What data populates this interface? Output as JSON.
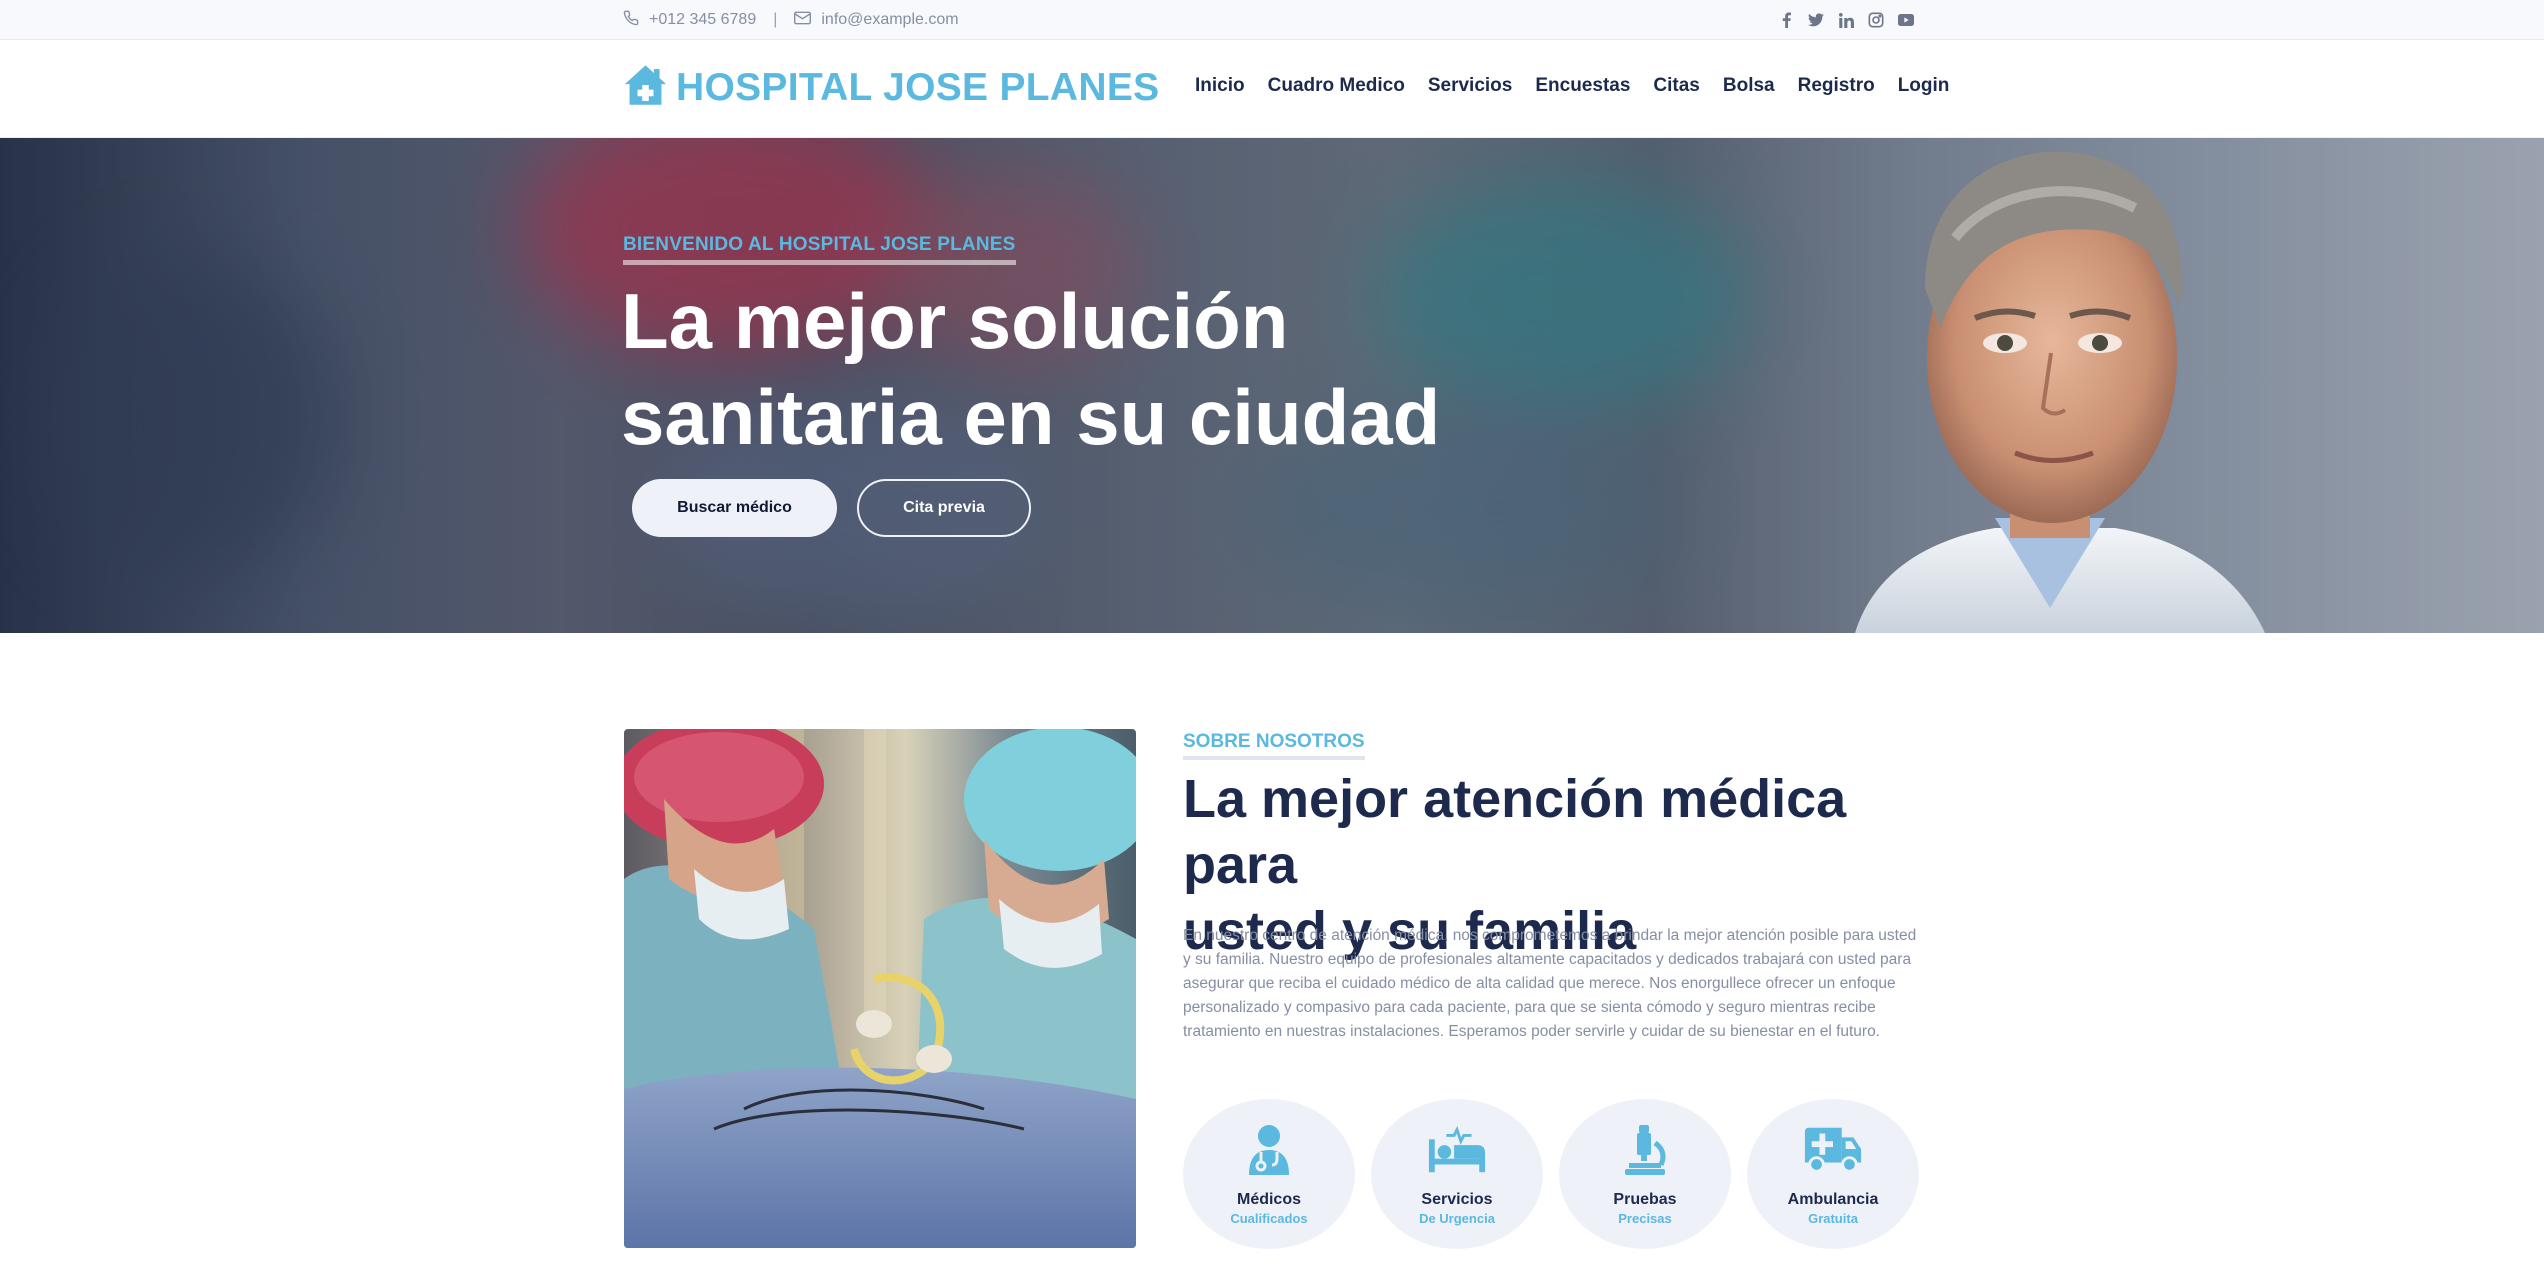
{
  "topbar": {
    "phone": "+012 345 6789",
    "separator": "|",
    "email": "info@example.com",
    "social_icons": [
      "facebook-icon",
      "twitter-icon",
      "linkedin-icon",
      "instagram-icon",
      "youtube-icon"
    ]
  },
  "brand": {
    "name": "HOSPITAL JOSE PLANES",
    "icon": "hospital-house-icon",
    "color": "#5bb8de"
  },
  "nav": {
    "items": [
      "Inicio",
      "Cuadro Medico",
      "Servicios",
      "Encuestas",
      "Citas",
      "Bolsa",
      "Registro",
      "Login"
    ]
  },
  "hero": {
    "subtitle": "BIENVENIDO AL HOSPITAL JOSE PLANES",
    "title_line1": "La mejor solución",
    "title_line2": "sanitaria en su ciudad",
    "primary_button": "Buscar médico",
    "secondary_button": "Cita previa"
  },
  "about": {
    "subtitle": "SOBRE NOSOTROS",
    "title_line1": "La mejor atención médica para",
    "title_line2": "usted y su familia",
    "text": "En nuestro centro de atención médica, nos comprometemos a brindar la mejor atención posible para usted y su familia. Nuestro equipo de profesionales altamente capacitados y dedicados trabajará con usted para asegurar que reciba el cuidado médico de alta calidad que merece. Nos enorgullece ofrecer un enfoque personalizado y compasivo para cada paciente, para que se sienta cómodo y seguro mientras recibe tratamiento en nuestras instalaciones. Esperamos poder servirle y cuidar de su bienestar en el futuro.",
    "features": [
      {
        "title": "Médicos",
        "subtitle": "Cualificados",
        "icon": "doctor-icon"
      },
      {
        "title": "Servicios",
        "subtitle": "De Urgencia",
        "icon": "hospital-bed-icon"
      },
      {
        "title": "Pruebas",
        "subtitle": "Precisas",
        "icon": "microscope-icon"
      },
      {
        "title": "Ambulancia",
        "subtitle": "Gratuita",
        "icon": "ambulance-icon"
      }
    ]
  },
  "colors": {
    "accent": "#5bb8de",
    "dark": "#1d2a4d",
    "muted": "#858ea3",
    "light_bg": "#eef1f8"
  }
}
